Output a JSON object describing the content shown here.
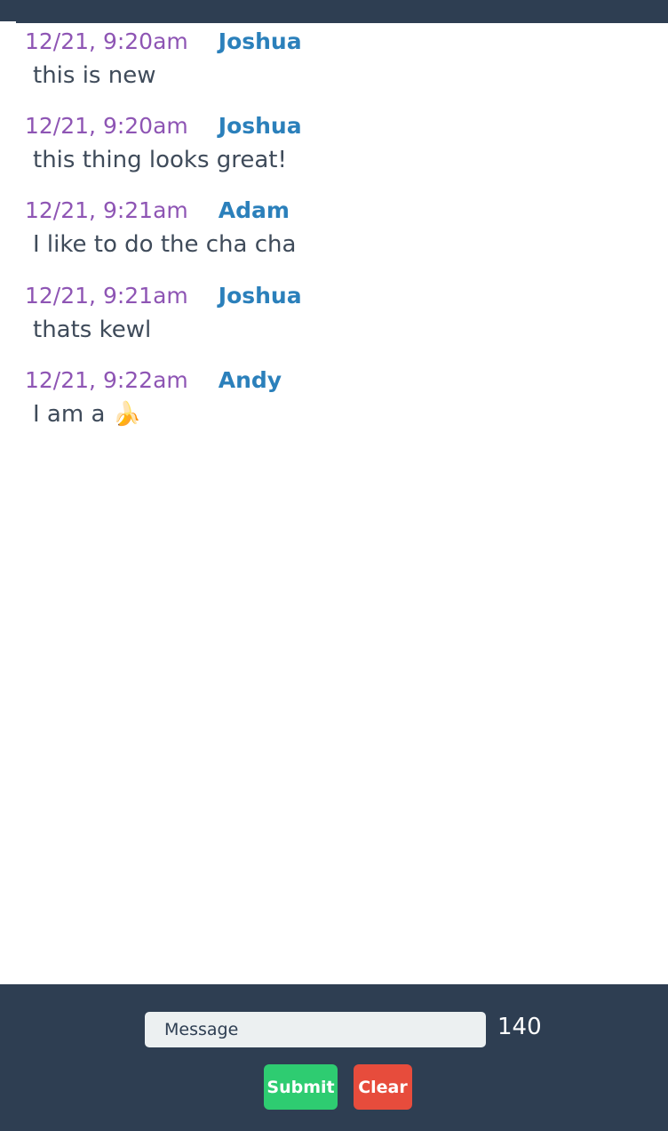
{
  "messages": [
    {
      "timestamp": "12/21, 9:20am",
      "author": "Joshua",
      "text": "this is new"
    },
    {
      "timestamp": "12/21, 9:20am",
      "author": "Joshua",
      "text": "this thing looks great!"
    },
    {
      "timestamp": "12/21, 9:21am",
      "author": "Adam",
      "text": "I like to do the cha cha"
    },
    {
      "timestamp": "12/21, 9:21am",
      "author": "Joshua",
      "text": "thats kewl"
    },
    {
      "timestamp": "12/21, 9:22am",
      "author": "Andy",
      "text": "I am a 🍌"
    }
  ],
  "composer": {
    "placeholder": "Message",
    "value": "",
    "char_count": "140",
    "submit_label": "Submit",
    "clear_label": "Clear"
  },
  "colors": {
    "header_bg": "#2e3e52",
    "timestamp": "#8e55b4",
    "author": "#2b80bb",
    "message_text": "#3f4b5a",
    "submit": "#2ecc71",
    "clear": "#e74c3c"
  }
}
